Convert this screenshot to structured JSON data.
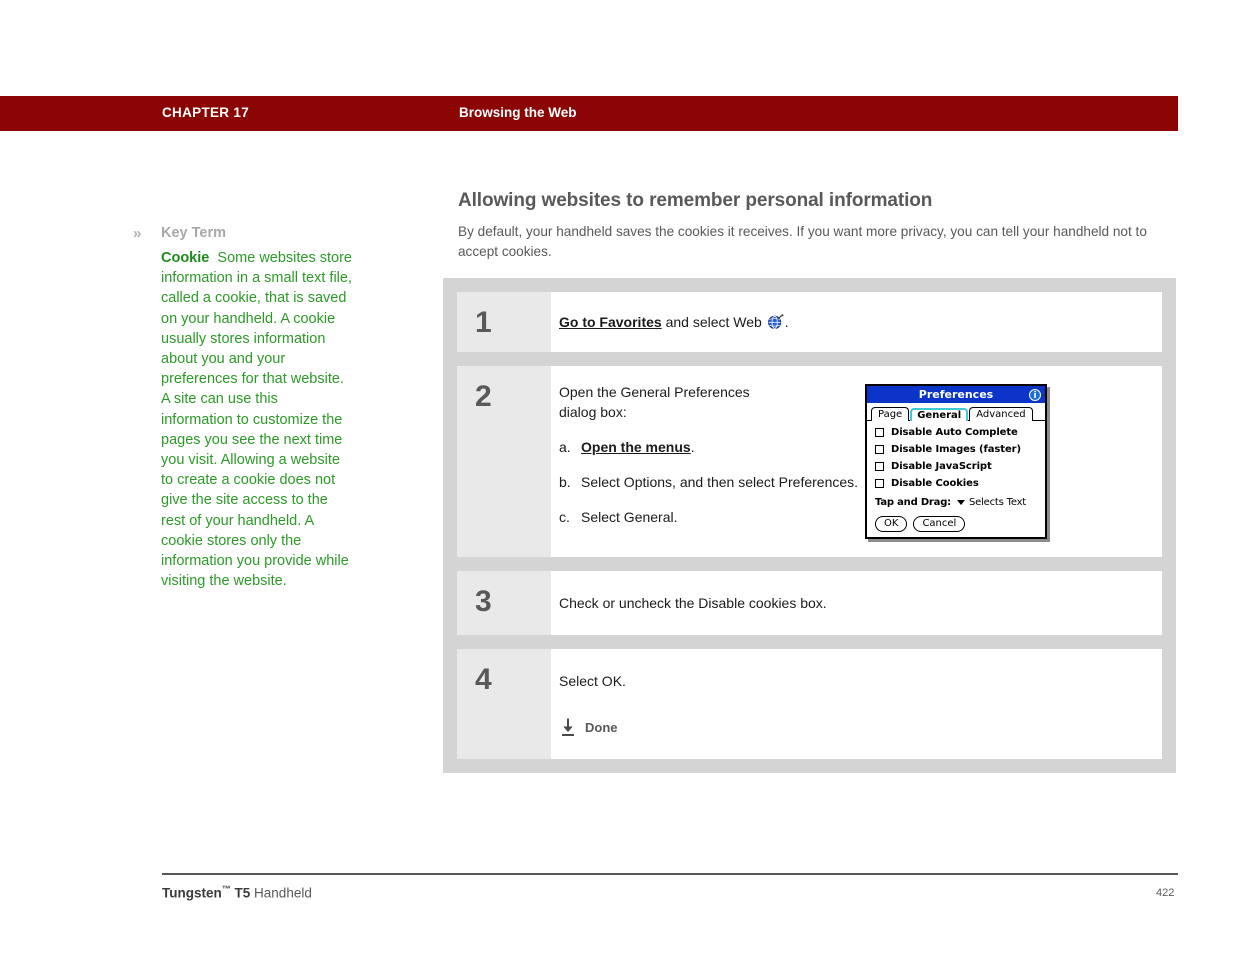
{
  "header": {
    "chapter_label": "CHAPTER 17",
    "chapter_title": "Browsing the Web",
    "bar_color": "#8b0505"
  },
  "sidebar": {
    "chevron": "»",
    "keyterm_title": "Key Term",
    "term": "Cookie",
    "definition": "Some websites store information in a small text file, called a cookie, that is saved on your handheld. A cookie usually stores information about you and your preferences for that website. A site can use this information to customize the pages you see the next time you visit. Allowing a website to create a cookie does not give the site access to the rest of your handheld. A cookie stores only the information you provide while visiting the website.",
    "text_color": "#2d9a28"
  },
  "main": {
    "heading": "Allowing websites to remember personal information",
    "intro": "By default, your handheld saves the cookies it receives. If you want more privacy, you can tell your handheld not to accept cookies."
  },
  "steps": [
    {
      "number": "1",
      "link_text": "Go to Favorites",
      "text_after": " and select Web ",
      "text_end": "."
    },
    {
      "number": "2",
      "intro_line1": "Open the General Preferences",
      "intro_line2": "dialog box:",
      "substeps": [
        {
          "marker": "a.",
          "link_text": "Open the menus",
          "text_after": "."
        },
        {
          "marker": "b.",
          "text": "Select Options, and then select Preferences."
        },
        {
          "marker": "c.",
          "text": "Select General."
        }
      ]
    },
    {
      "number": "3",
      "text": "Check or uncheck the Disable cookies box."
    },
    {
      "number": "4",
      "text": "Select OK.",
      "done_label": "Done"
    }
  ],
  "prefs_dialog": {
    "title": "Preferences",
    "info_glyph": "i",
    "tabs": [
      {
        "label": "Page",
        "active": false
      },
      {
        "label": "General",
        "active": true
      },
      {
        "label": "Advanced",
        "active": false
      }
    ],
    "checkboxes": [
      {
        "label": "Disable Auto Complete",
        "checked": false
      },
      {
        "label": "Disable Images (faster)",
        "checked": false
      },
      {
        "label": "Disable JavaScript",
        "checked": false
      },
      {
        "label": "Disable Cookies",
        "checked": false
      }
    ],
    "select_label": "Tap and Drag:",
    "select_value": "Selects Text",
    "ok_label": "OK",
    "cancel_label": "Cancel",
    "titlebar_color": "#0a35c8",
    "active_tab_color": "#3ec8d8"
  },
  "footer": {
    "brand": "Tungsten",
    "tm": "™",
    "model": "T5",
    "product": "Handheld",
    "page_number": "422"
  }
}
